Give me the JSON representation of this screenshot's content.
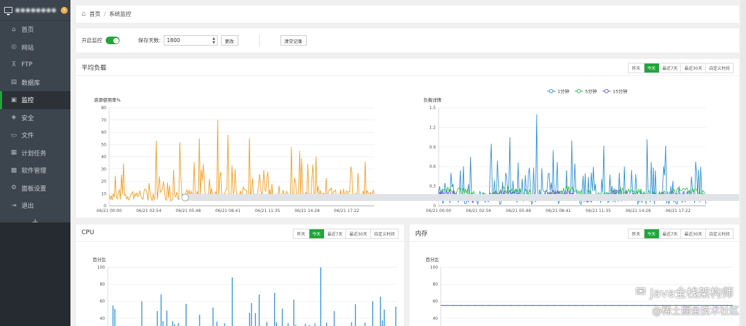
{
  "sidebar": {
    "hostname": "●●●●●●●●",
    "badge": "5",
    "items": [
      {
        "label": "首页",
        "icon": "home-icon",
        "glyph": "⌂"
      },
      {
        "label": "网站",
        "icon": "globe-icon",
        "glyph": "◎"
      },
      {
        "label": "FTP",
        "icon": "ftp-icon",
        "glyph": "⊼"
      },
      {
        "label": "数据库",
        "icon": "database-icon",
        "glyph": "▤"
      },
      {
        "label": "监控",
        "icon": "monitor-icon",
        "glyph": "▣"
      },
      {
        "label": "安全",
        "icon": "shield-icon",
        "glyph": "◈"
      },
      {
        "label": "文件",
        "icon": "folder-icon",
        "glyph": "▭"
      },
      {
        "label": "计划任务",
        "icon": "task-icon",
        "glyph": "▦"
      },
      {
        "label": "软件管理",
        "icon": "apps-icon",
        "glyph": "▩"
      },
      {
        "label": "面板设置",
        "icon": "settings-icon",
        "glyph": "⚙"
      },
      {
        "label": "退出",
        "icon": "logout-icon",
        "glyph": "⇥"
      }
    ],
    "add_label": "+"
  },
  "breadcrumb": {
    "home": "首页",
    "sep": "/",
    "current": "系统监控"
  },
  "toolbar": {
    "monitor_label": "开启监控",
    "monitor_on": true,
    "days_label": "保存天数:",
    "days_value": "1800",
    "change_label": "更改",
    "clear_label": "清空记录"
  },
  "ranges": [
    "昨天",
    "今天",
    "最近7天",
    "最近30天",
    "自定义时间"
  ],
  "active_range": "今天",
  "panels": {
    "load_title": "平均负载",
    "cpu_title": "CPU",
    "mem_title": "内存"
  },
  "colors": {
    "accent": "#20a53a",
    "orange": "#f39b1e",
    "blue": "#2e8fd3",
    "green": "#27c23d",
    "purple": "#7b52d8"
  },
  "chart_data": [
    {
      "type": "line",
      "ylabel": "资源使用率%",
      "ylim": [
        0,
        80
      ],
      "yticks": [
        0,
        10,
        20,
        30,
        40,
        50,
        60,
        70,
        80
      ],
      "xticks": [
        "06/21 00:00",
        "06/21 02:54",
        "06/21 05:48",
        "06/21 08:41",
        "06/21 11:35",
        "06/21 14:28",
        "06/21 17:22"
      ],
      "series": [
        {
          "color": "#f39b1e",
          "baseline": [
            4,
            14
          ],
          "peaks": [
            [
              0.18,
              53
            ],
            [
              0.27,
              52
            ],
            [
              0.34,
              55
            ],
            [
              0.41,
              70
            ],
            [
              0.45,
              58
            ],
            [
              0.53,
              55
            ],
            [
              0.69,
              48
            ],
            [
              0.72,
              45
            ],
            [
              0.78,
              40
            ]
          ]
        }
      ]
    },
    {
      "type": "line",
      "ylabel": "负载详情",
      "ylim": [
        0,
        1.5
      ],
      "yticks": [
        0,
        0.3,
        0.6,
        0.9,
        1.2,
        1.5
      ],
      "xticks": [
        "06/21 00:00",
        "06/21 02:54",
        "06/21 05:48",
        "06/21 08:41",
        "06/21 11:35",
        "06/21 14:28",
        "06/21 17:22"
      ],
      "legend": [
        "1分钟",
        "5分钟",
        "15分钟"
      ],
      "series": [
        {
          "name": "1分钟",
          "color": "#2e8fd3",
          "peaks": [
            [
              0.12,
              0.75
            ],
            [
              0.2,
              0.95
            ],
            [
              0.27,
              1.05
            ],
            [
              0.37,
              1.4
            ],
            [
              0.43,
              0.85
            ],
            [
              0.5,
              1.0
            ],
            [
              0.62,
              0.92
            ],
            [
              0.78,
              1.02
            ],
            [
              0.85,
              0.92
            ]
          ]
        },
        {
          "name": "5分钟",
          "color": "#27c23d",
          "level": 0.2
        },
        {
          "name": "15分钟",
          "color": "#7b52d8",
          "level": 0.15
        }
      ]
    },
    {
      "type": "bar",
      "ylabel": "百分比",
      "ylim": [
        0,
        100
      ],
      "yticks": [
        40,
        60,
        80,
        100
      ],
      "series": [
        {
          "color": "#2e8fd3",
          "peaks": [
            [
              0.02,
              55
            ],
            [
              0.12,
              60
            ],
            [
              0.27,
              57
            ],
            [
              0.43,
              88
            ],
            [
              0.5,
              58
            ],
            [
              0.58,
              70
            ],
            [
              0.65,
              62
            ],
            [
              0.74,
              100
            ],
            [
              0.92,
              60
            ]
          ]
        }
      ]
    },
    {
      "type": "line",
      "ylabel": "百分比",
      "ylim": [
        0,
        100
      ],
      "yticks": [
        40,
        60,
        80,
        100
      ],
      "series": [
        {
          "color": "#2e8fd3",
          "level": 55
        }
      ]
    }
  ],
  "watermark": {
    "line1": "Java全栈架构师",
    "line2": "@稀土掘金技术社区"
  }
}
